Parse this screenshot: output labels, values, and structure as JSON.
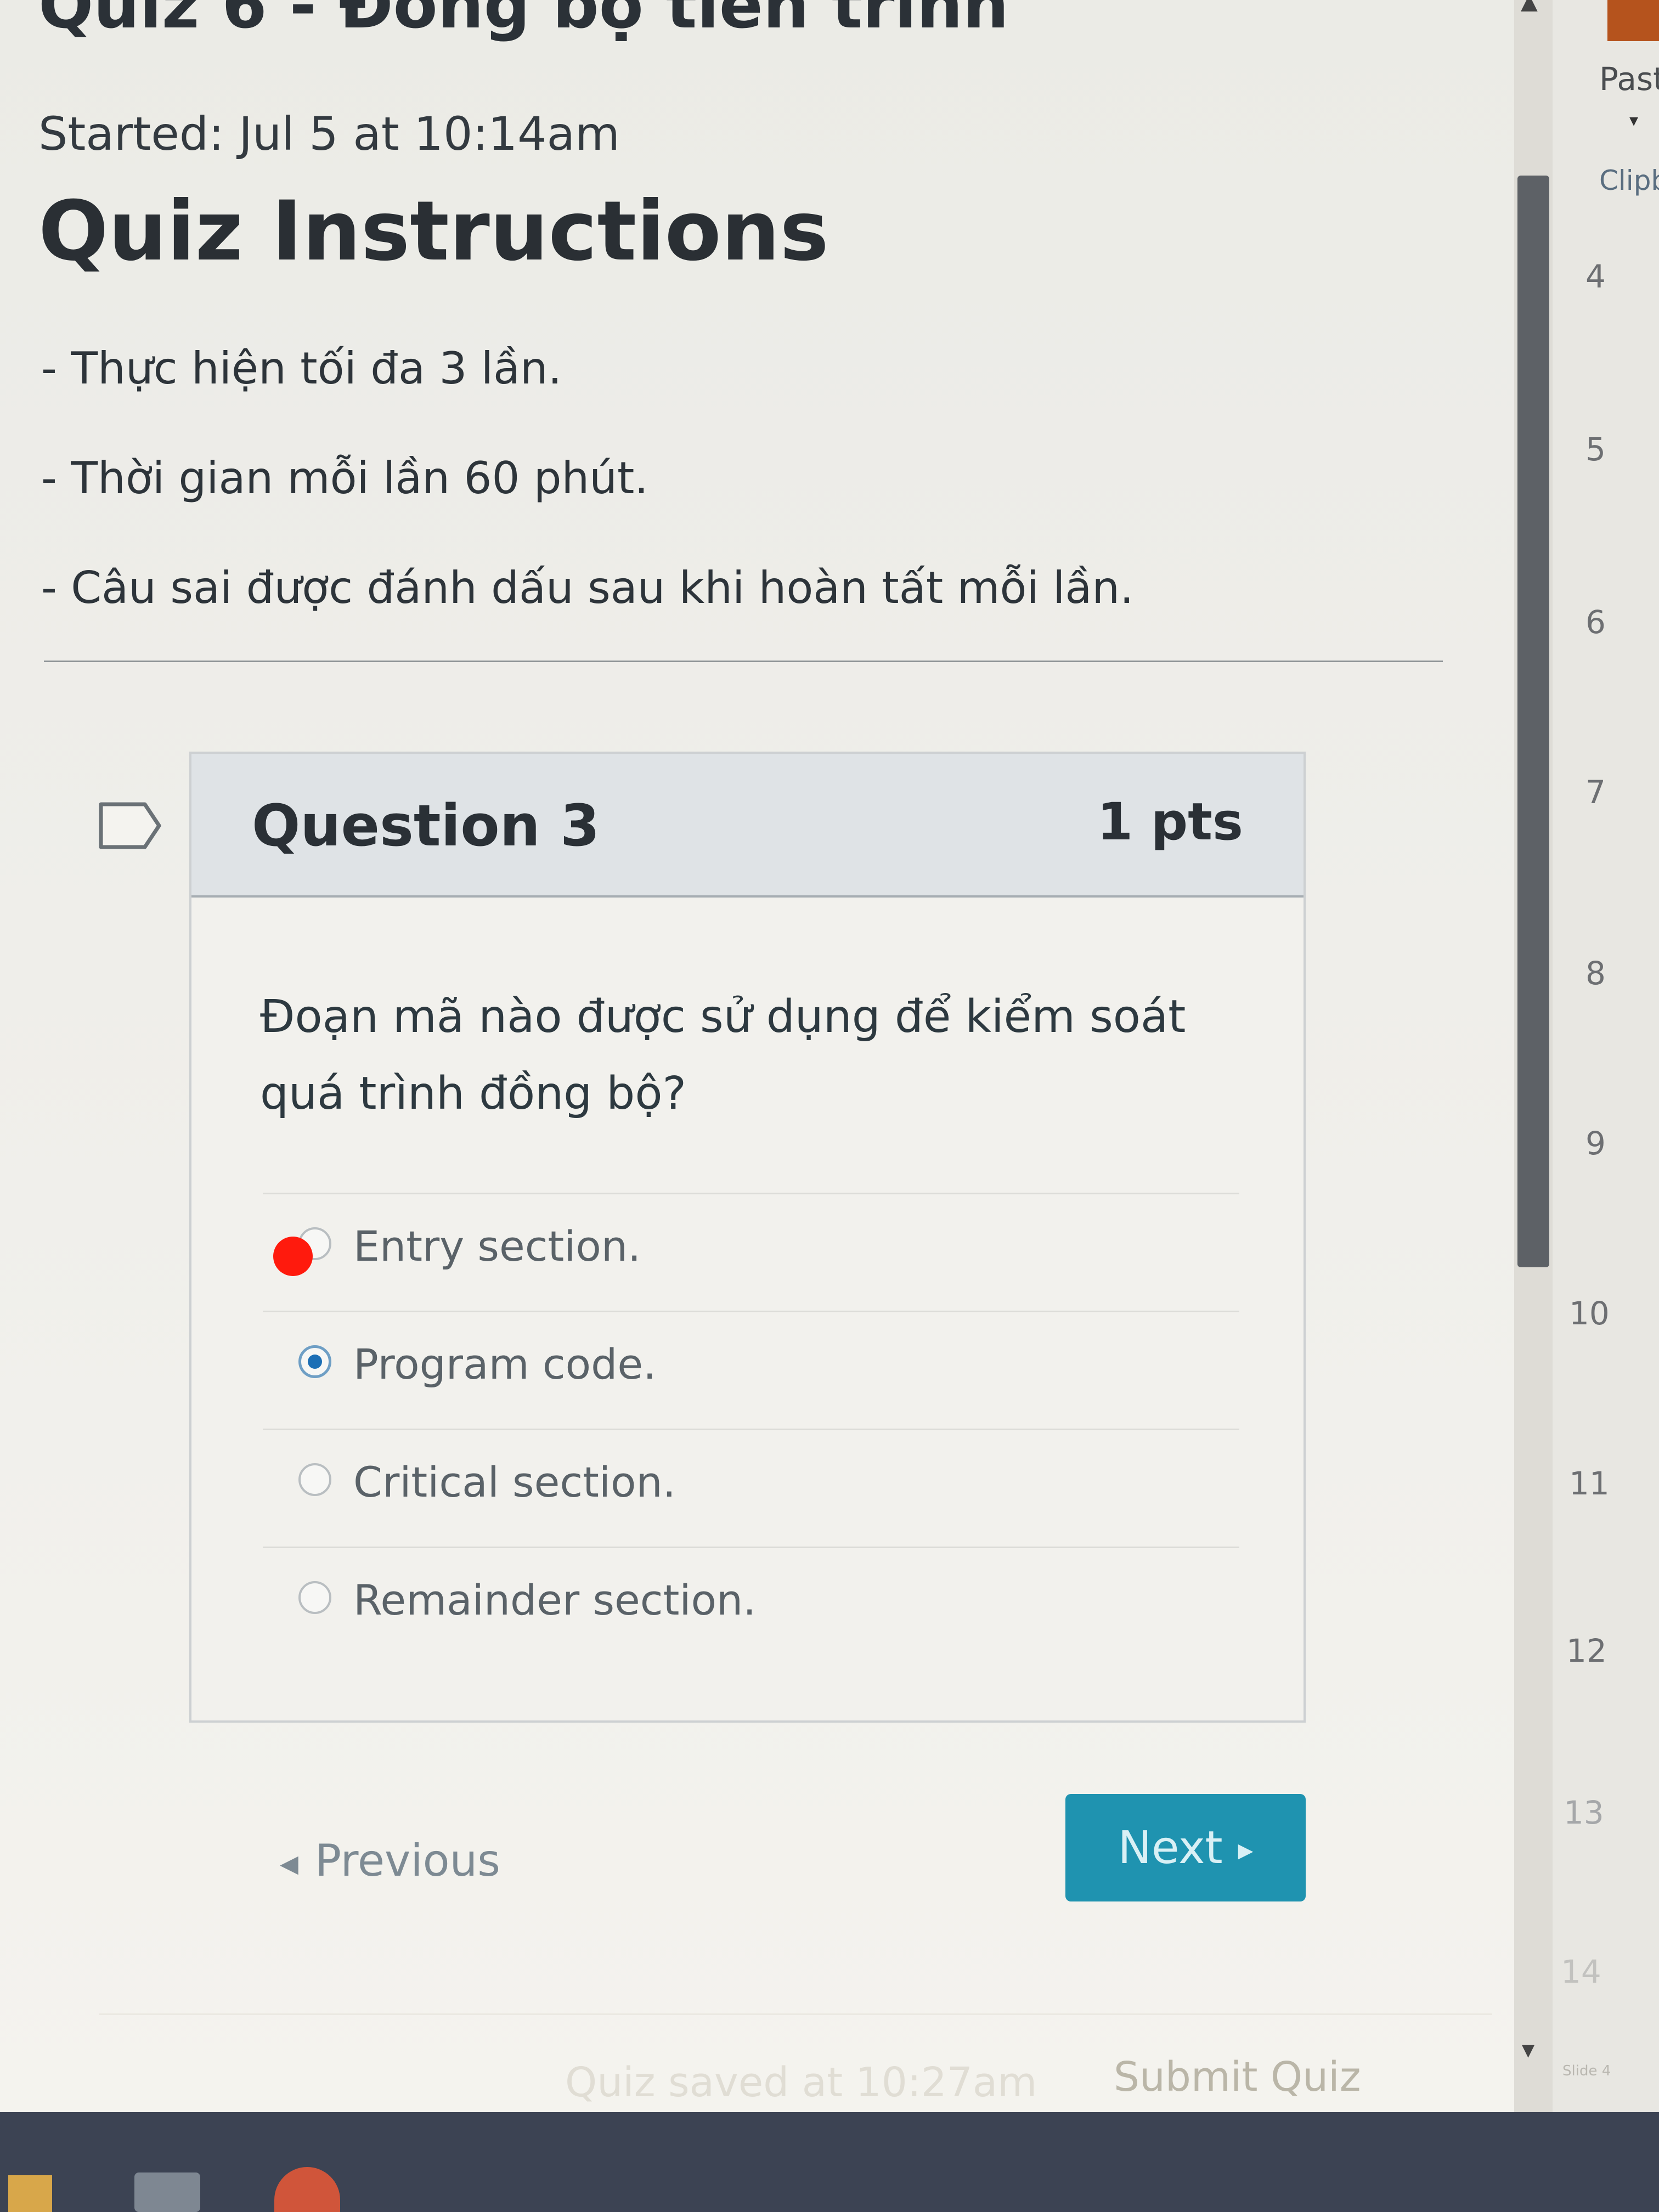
{
  "quiz": {
    "title": "Quiz 6 - Đồng bộ tiến trình",
    "started": "Started: Jul 5 at 10:14am",
    "instructions_heading": "Quiz Instructions",
    "instructions": [
      "- Thực hiện tối đa 3 lần.",
      "- Thời gian mỗi lần 60 phút.",
      "- Câu sai được đánh dấu sau khi hoàn tất mỗi lần."
    ]
  },
  "question": {
    "title": "Question 3",
    "points": "1 pts",
    "text": "Đoạn mã nào được sử dụng để kiểm soát quá trình đồng bộ?",
    "answers": [
      {
        "label": "Entry section.",
        "selected": false
      },
      {
        "label": "Program code.",
        "selected": true
      },
      {
        "label": "Critical section.",
        "selected": false
      },
      {
        "label": "Remainder section.",
        "selected": false
      }
    ]
  },
  "navigation": {
    "previous_label": "Previous",
    "next_label": "Next"
  },
  "footer": {
    "saved_text": "Quiz saved at 10:27am",
    "submit_label": "Submit Quiz"
  },
  "side_app": {
    "paste_label": "Past",
    "clipboard_label": "Clipb",
    "slide_numbers": [
      "4",
      "5",
      "6",
      "7",
      "8",
      "9",
      "10",
      "11",
      "12",
      "13",
      "14"
    ],
    "slide_label": "Slide 4"
  },
  "colors": {
    "next_button": "#1f93b0",
    "selected_radio": "#1c6fb5",
    "annotation_dot": "#ff1a0d"
  }
}
